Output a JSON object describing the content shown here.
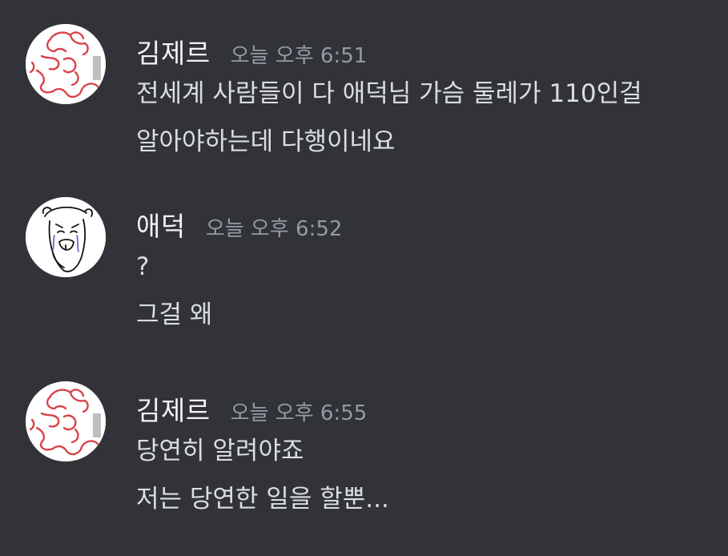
{
  "messages": [
    {
      "username": "김제르",
      "timestamp": "오늘 오후 6:51",
      "lines": [
        "전세계 사람들이 다 애덕님 가슴 둘레가 110인걸",
        "알아야하는데 다행이네요"
      ]
    },
    {
      "username": "애덕",
      "timestamp": "오늘 오후 6:52",
      "lines": [
        "?",
        "그걸 왜"
      ]
    },
    {
      "username": "김제르",
      "timestamp": "오늘 오후 6:55",
      "lines": [
        "당연히 알려야죠",
        "저는 당연한 일을 할뿐..."
      ]
    }
  ],
  "colors": {
    "background": "#313338",
    "username": "#f2f3f5",
    "timestamp": "#949ba4",
    "message_text": "#dbdee1",
    "avatar_sketch_red": "#d9434a"
  }
}
